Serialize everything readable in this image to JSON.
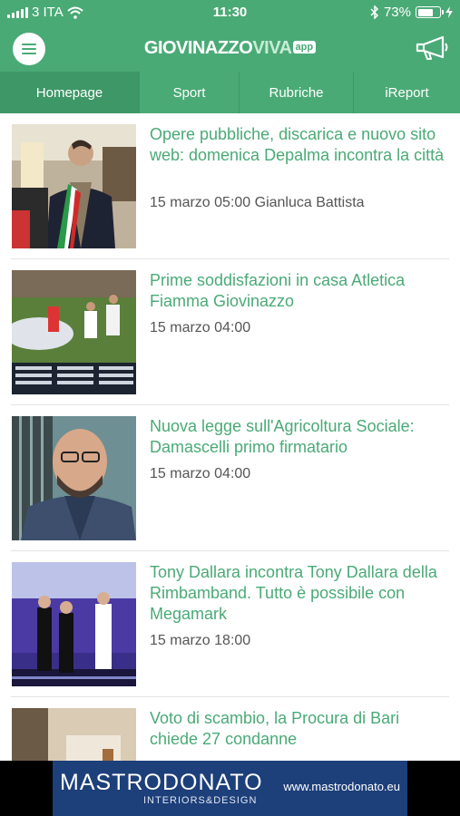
{
  "status_bar": {
    "carrier": "3 ITA",
    "time": "11:30",
    "battery": "73%",
    "battery_level": 0.73
  },
  "header": {
    "logo_part1": "GIOVINAZZO",
    "logo_part2": "VIVA",
    "logo_badge": "app",
    "menu_icon": "hamburger-icon",
    "megaphone_icon": "megaphone-icon"
  },
  "tabs": [
    {
      "label": "Homepage",
      "active": true
    },
    {
      "label": "Sport",
      "active": false
    },
    {
      "label": "Rubriche",
      "active": false
    },
    {
      "label": "iReport",
      "active": false
    }
  ],
  "articles": [
    {
      "title": "Opere pubbliche, discarica e nuovo sito web: domenica Depalma incontra la città",
      "meta": "15 marzo 05:00 Gianluca Battista"
    },
    {
      "title": "Prime soddisfazioni in casa Atletica Fiamma Giovinazzo",
      "meta": "15 marzo 04:00"
    },
    {
      "title": "Nuova legge sull'Agricoltura Sociale: Damascelli primo firmatario",
      "meta": "15 marzo 04:00"
    },
    {
      "title": "Tony Dallara incontra Tony Dallara della Rimbamband. Tutto è possibile con Megamark",
      "meta": "15 marzo 18:00"
    },
    {
      "title": "Voto di scambio, la Procura di Bari chiede 27 condanne",
      "meta": ""
    }
  ],
  "banner": {
    "brand": "MASTRODONATO",
    "subtitle": "INTERIORS&DESIGN",
    "url": "www.mastrodonato.eu"
  },
  "colors": {
    "accent": "#4aaa76",
    "tab_active": "#3e9767",
    "banner_bg": "#1d3f7a"
  }
}
